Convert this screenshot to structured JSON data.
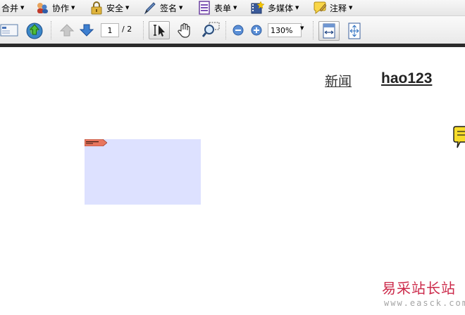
{
  "menubar": {
    "items": [
      {
        "label": "合并",
        "icon": "merge-icon"
      },
      {
        "label": "协作",
        "icon": "collaborate-icon"
      },
      {
        "label": "安全",
        "icon": "lock-icon"
      },
      {
        "label": "签名",
        "icon": "pen-icon"
      },
      {
        "label": "表单",
        "icon": "form-icon"
      },
      {
        "label": "多媒体",
        "icon": "multimedia-icon"
      },
      {
        "label": "注释",
        "icon": "comment-icon"
      }
    ]
  },
  "toolbar": {
    "current_page": "1",
    "page_total": "/ 2",
    "zoom": "130%"
  },
  "document": {
    "link_news": "新闻",
    "link_hao123": "hao123"
  },
  "watermark": {
    "text": "易采站长站",
    "url": "www.easck.com"
  },
  "colors": {
    "annotation_fill": "#dde1ff",
    "watermark_red": "#cc2a4a",
    "toolbar_bottom": "#2b2b2b"
  }
}
